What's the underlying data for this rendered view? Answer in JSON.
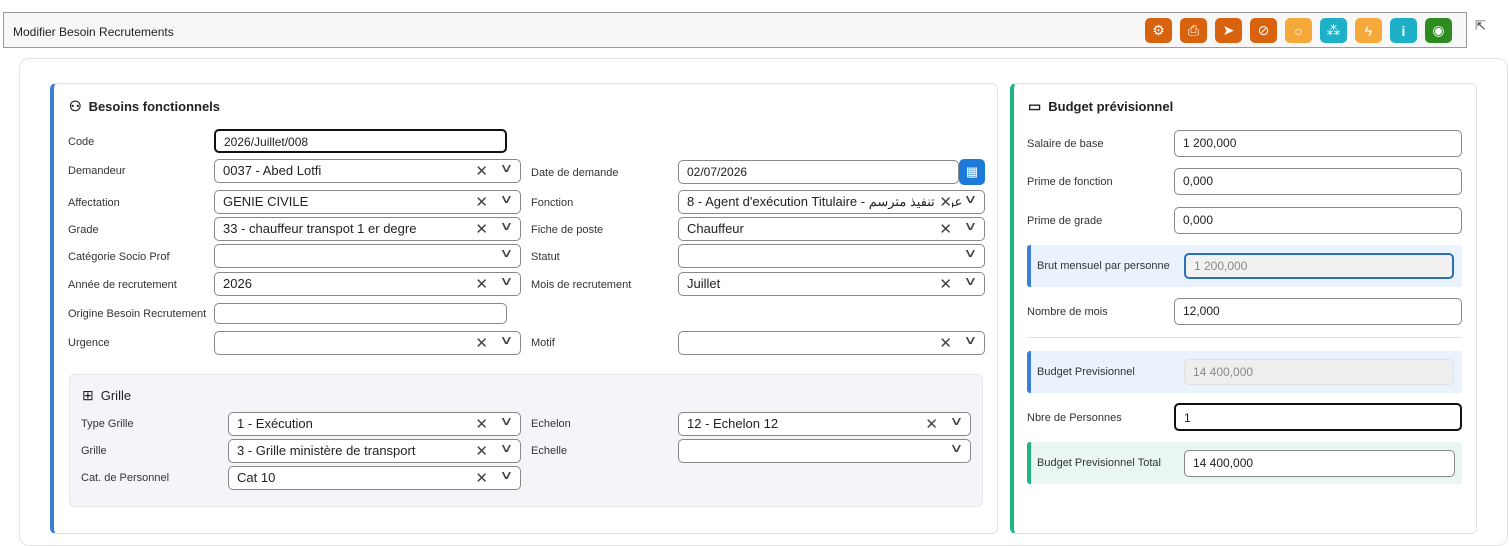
{
  "header": {
    "title": "Modifier Besoin Recrutements",
    "toolbar": [
      {
        "icon": "workflow-icon",
        "color": "#d9620f"
      },
      {
        "icon": "print-icon",
        "color": "#d9620f"
      },
      {
        "icon": "send-icon",
        "color": "#d9620f"
      },
      {
        "icon": "attachment-icon",
        "color": "#d9620f"
      },
      {
        "icon": "comment-icon",
        "color": "#f6a93b"
      },
      {
        "icon": "hierarchy-icon",
        "color": "#1db0c7"
      },
      {
        "icon": "bolt-icon",
        "color": "#f6a93b"
      },
      {
        "icon": "info-icon",
        "color": "#1db0c7"
      },
      {
        "icon": "eye-icon",
        "color": "#2e8b1e"
      }
    ]
  },
  "left": {
    "title": "Besoins fonctionnels",
    "code": {
      "label": "Code",
      "value": "2026/Juillet/008"
    },
    "demandeur": {
      "label": "Demandeur",
      "value": "0037 - Abed Lotfi"
    },
    "date_demande": {
      "label": "Date de demande",
      "value": "02/07/2026"
    },
    "affectation": {
      "label": "Affectation",
      "value": "GENIE CIVILE"
    },
    "fonction": {
      "label": "Fonction",
      "value": "8 - Agent d'exécution Titulaire - عون تنفيذ مترسم"
    },
    "grade": {
      "label": "Grade",
      "value": "33 - chauffeur transpot 1 er degre"
    },
    "fiche_poste": {
      "label": "Fiche de poste",
      "value": "Chauffeur"
    },
    "categorie": {
      "label": "Catégorie Socio Prof",
      "value": ""
    },
    "statut": {
      "label": "Statut",
      "value": ""
    },
    "annee": {
      "label": "Année de recrutement",
      "value": "2026"
    },
    "mois": {
      "label": "Mois de recrutement",
      "value": "Juillet"
    },
    "origine": {
      "label": "Origine Besoin Recrutement",
      "value": ""
    },
    "urgence": {
      "label": "Urgence",
      "value": ""
    },
    "motif": {
      "label": "Motif",
      "value": ""
    },
    "grille_section": {
      "title": "Grille",
      "type_grille": {
        "label": "Type Grille",
        "value": "1 - Exécution"
      },
      "echelon": {
        "label": "Echelon",
        "value": "12 - Echelon 12"
      },
      "grille": {
        "label": "Grille",
        "value": "3 - Grille ministère de transport"
      },
      "echelle": {
        "label": "Echelle",
        "value": ""
      },
      "cat_personnel": {
        "label": "Cat. de Personnel",
        "value": "Cat 10"
      }
    }
  },
  "right": {
    "title": "Budget prévisionnel",
    "salaire_base": {
      "label": "Salaire de base",
      "value": "1 200,000"
    },
    "prime_fonction": {
      "label": "Prime de fonction",
      "value": "0,000"
    },
    "prime_grade": {
      "label": "Prime de grade",
      "value": "0,000"
    },
    "brut_mensuel": {
      "label": "Brut mensuel par personne",
      "value": "1 200,000"
    },
    "nombre_mois": {
      "label": "Nombre de mois",
      "value": "12,000"
    },
    "budget_prev": {
      "label": "Budget Previsionnel",
      "value": "14 400,000"
    },
    "nbre_personnes": {
      "label": "Nbre de Personnes",
      "value": "1"
    },
    "budget_total": {
      "label": "Budget Previsionnel Total",
      "value": "14 400,000"
    }
  }
}
